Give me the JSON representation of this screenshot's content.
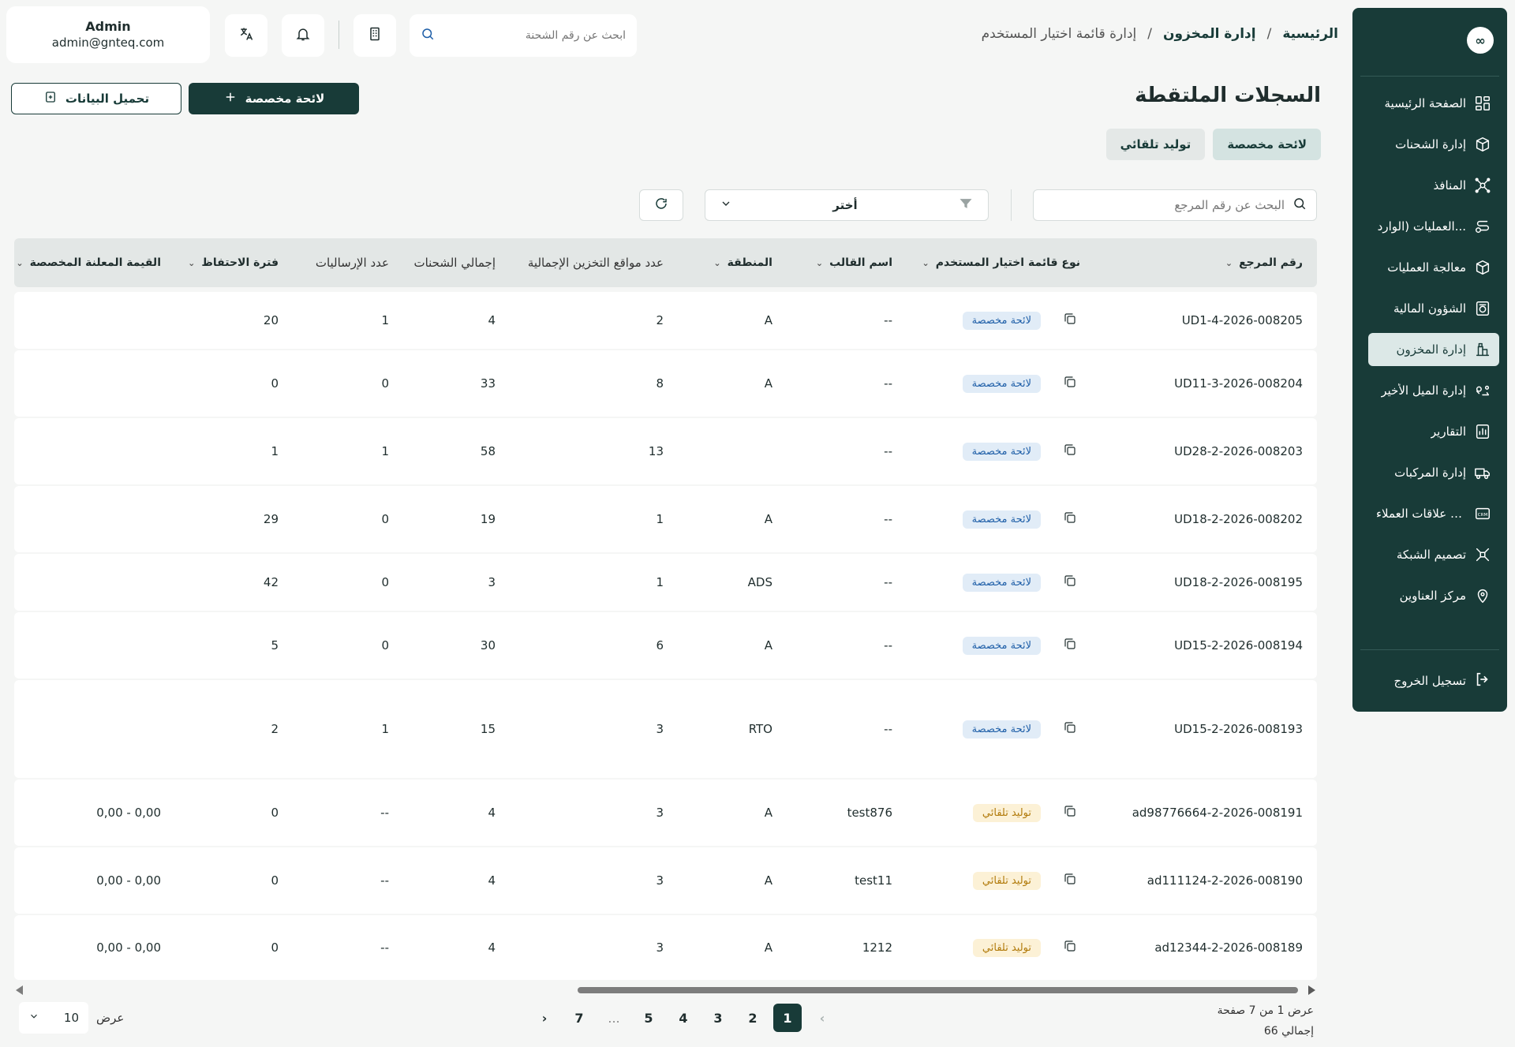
{
  "sidebar": {
    "items": [
      {
        "label": "الصفحة الرئيسية",
        "icon": "dashboard-icon",
        "active": false
      },
      {
        "label": "إدارة الشحنات",
        "icon": "package-icon",
        "active": false
      },
      {
        "label": "المنافذ",
        "icon": "network-icon",
        "active": false
      },
      {
        "label": "العمليات (الوارد...",
        "icon": "route-icon",
        "active": false
      },
      {
        "label": "معالجة العمليات",
        "icon": "box-icon",
        "active": false
      },
      {
        "label": "الشؤون المالية",
        "icon": "finance-icon",
        "active": false
      },
      {
        "label": "إدارة المخزون",
        "icon": "inventory-icon",
        "active": true
      },
      {
        "label": "إدارة الميل الأخير",
        "icon": "last-mile-icon",
        "active": false
      },
      {
        "label": "التقارير",
        "icon": "reports-icon",
        "active": false
      },
      {
        "label": "إدارة المركبات",
        "icon": "truck-icon",
        "active": false
      },
      {
        "label": "إدارة علاقات العملاء",
        "icon": "crm-icon",
        "active": false
      },
      {
        "label": "تصميم الشبكة",
        "icon": "network-design-icon",
        "active": false
      },
      {
        "label": "مركز العناوين",
        "icon": "address-icon",
        "active": false
      }
    ],
    "logout_label": "تسجيل الخروج"
  },
  "header": {
    "user_name": "Admin",
    "user_email": "admin@gnteq.com",
    "search_placeholder": "ابحث عن رقم الشحنة",
    "breadcrumb": [
      "الرئيسية",
      "إدارة المخزون",
      "إدارة قائمة اختيار المستخدم"
    ]
  },
  "page": {
    "title": "السجلات الملتقطة",
    "new_button": "لائحة مخصصة",
    "upload_button": "تحميل البيانات",
    "tabs": [
      "لائحة مخصصة",
      "توليد تلقائي"
    ],
    "ref_search_placeholder": "البحث عن رقم المرجع",
    "filter_value": "أختر"
  },
  "table": {
    "columns": [
      "رقم المرجع",
      "نوع قائمة اختيار المستخدم",
      "اسم القالب",
      "المنطقة",
      "عدد مواقع التخزين الإجمالية",
      "إجمالي الشحنات",
      "عدد الإرساليات",
      "فترة الاحتفاظ",
      "القيمة المعلنة المخصصة"
    ],
    "rows": [
      {
        "ref": "UD1-4-2026-008205",
        "type": "لائحة مخصصة",
        "type_kind": "custom",
        "template": "--",
        "zone": "A",
        "locations": "2",
        "shipments": "4",
        "consignments": "1",
        "retention": "20",
        "declared": ""
      },
      {
        "ref": "UD11-3-2026-008204",
        "type": "لائحة مخصصة",
        "type_kind": "custom",
        "template": "--",
        "zone": "A",
        "locations": "8",
        "shipments": "33",
        "consignments": "0",
        "retention": "0",
        "declared": ""
      },
      {
        "ref": "UD28-2-2026-008203",
        "type": "لائحة مخصصة",
        "type_kind": "custom",
        "template": "--",
        "zone": "",
        "locations": "13",
        "shipments": "58",
        "consignments": "1",
        "retention": "1",
        "declared": ""
      },
      {
        "ref": "UD18-2-2026-008202",
        "type": "لائحة مخصصة",
        "type_kind": "custom",
        "template": "--",
        "zone": "A",
        "locations": "1",
        "shipments": "19",
        "consignments": "0",
        "retention": "29",
        "declared": ""
      },
      {
        "ref": "UD18-2-2026-008195",
        "type": "لائحة مخصصة",
        "type_kind": "custom",
        "template": "--",
        "zone": "ADS",
        "locations": "1",
        "shipments": "3",
        "consignments": "0",
        "retention": "42",
        "declared": ""
      },
      {
        "ref": "UD15-2-2026-008194",
        "type": "لائحة مخصصة",
        "type_kind": "custom",
        "template": "--",
        "zone": "A",
        "locations": "6",
        "shipments": "30",
        "consignments": "0",
        "retention": "5",
        "declared": ""
      },
      {
        "ref": "UD15-2-2026-008193",
        "type": "لائحة مخصصة",
        "type_kind": "custom",
        "template": "--",
        "zone": "RTO",
        "locations": "3",
        "shipments": "15",
        "consignments": "1",
        "retention": "2",
        "declared": ""
      },
      {
        "ref": "ad98776664-2-2026-008191",
        "type": "توليد تلقائي",
        "type_kind": "auto",
        "template": "test876",
        "zone": "A",
        "locations": "3",
        "shipments": "4",
        "consignments": "--",
        "retention": "0",
        "declared": "0,00 - 0,00"
      },
      {
        "ref": "ad111124-2-2026-008190",
        "type": "توليد تلقائي",
        "type_kind": "auto",
        "template": "test11",
        "zone": "A",
        "locations": "3",
        "shipments": "4",
        "consignments": "--",
        "retention": "0",
        "declared": "0,00 - 0,00"
      },
      {
        "ref": "ad12344-2-2026-008189",
        "type": "توليد تلقائي",
        "type_kind": "auto",
        "template": "1212",
        "zone": "A",
        "locations": "3",
        "shipments": "4",
        "consignments": "--",
        "retention": "0",
        "declared": "0,00 - 0,00"
      }
    ]
  },
  "pagination": {
    "page_size": "10",
    "show_label": "عرض",
    "pages": [
      "1",
      "2",
      "3",
      "4",
      "5",
      "...",
      "7"
    ],
    "current": "1",
    "info_line1": "عرض 1 من 7 صفحة",
    "info_line2": "إجمالي 66"
  },
  "colors": {
    "primary": "#183b38",
    "custom_badge": "#e1ecf7",
    "auto_badge": "#fcf1d6"
  }
}
